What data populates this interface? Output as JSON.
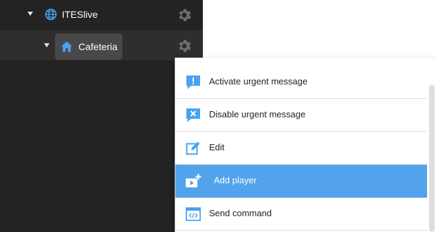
{
  "tree": {
    "root": {
      "label": "ITESlive",
      "icon": "globe-icon",
      "expanded": true
    },
    "child": {
      "label": "Cafeteria",
      "icon": "home-icon",
      "expanded": true,
      "selected": true
    }
  },
  "context_menu": {
    "items": [
      {
        "label": "Activate urgent message",
        "icon": "urgent-message-icon"
      },
      {
        "label": "Disable urgent message",
        "icon": "disable-message-icon"
      },
      {
        "label": "Edit",
        "icon": "edit-icon"
      },
      {
        "label": "Add player",
        "icon": "add-player-icon",
        "highlighted": true
      },
      {
        "label": "Send command",
        "icon": "send-command-icon"
      }
    ]
  },
  "colors": {
    "sidebar_bg": "#232323",
    "accent": "#52a3ec",
    "highlight_bg": "#52a3ec"
  }
}
